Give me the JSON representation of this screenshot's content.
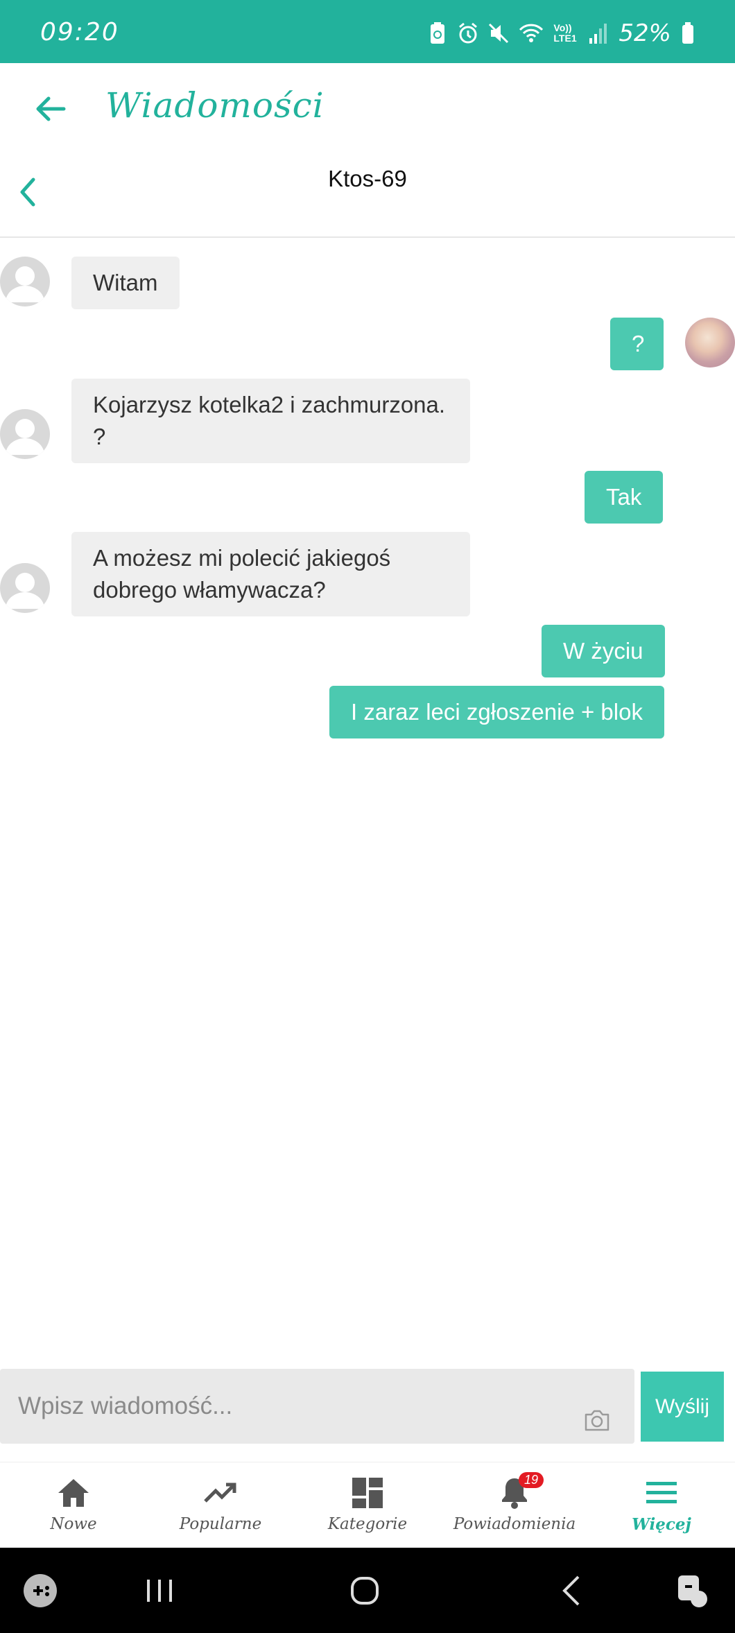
{
  "status_bar": {
    "time": "09:20",
    "battery": "52%",
    "network": "Vo)) LTE1"
  },
  "app_bar": {
    "title": "Wiadomości"
  },
  "conversation": {
    "contact_name": "Ktos-69"
  },
  "messages": [
    {
      "direction": "in",
      "text": "Witam"
    },
    {
      "direction": "out",
      "text": "?"
    },
    {
      "direction": "in",
      "text": "Kojarzysz kotelka2 i zachmurzona. ?"
    },
    {
      "direction": "out",
      "text": "Tak"
    },
    {
      "direction": "in",
      "text": "A możesz mi polecić jakiegoś dobrego włamywacza?"
    },
    {
      "direction": "out",
      "text": "W życiu"
    },
    {
      "direction": "out",
      "text": "I zaraz leci zgłoszenie + blok"
    }
  ],
  "composer": {
    "placeholder": "Wpisz wiadomość...",
    "send_label": "Wyślij"
  },
  "bottom_nav": {
    "items": [
      {
        "label": "Nowe",
        "icon": "home-icon"
      },
      {
        "label": "Popularne",
        "icon": "trending-icon"
      },
      {
        "label": "Kategorie",
        "icon": "dashboard-icon"
      },
      {
        "label": "Powiadomienia",
        "icon": "bell-icon",
        "badge": "19"
      },
      {
        "label": "Więcej",
        "icon": "menu-icon",
        "active": true
      }
    ]
  },
  "colors": {
    "accent": "#22b29c",
    "outgoing_bubble": "#4cc9b0",
    "incoming_bubble": "#efefef",
    "badge": "#e31b23"
  }
}
